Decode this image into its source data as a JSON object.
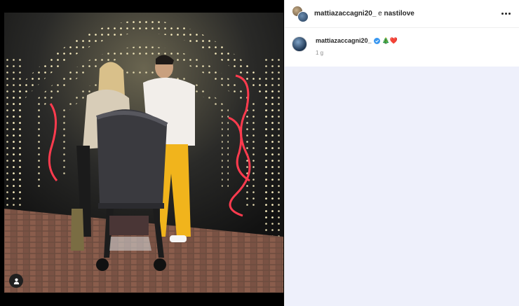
{
  "header": {
    "username": "mattiazaccagni20_",
    "connector": " e ",
    "collaborator": "nastilove"
  },
  "caption": {
    "username": "mattiazaccagni20_",
    "emojis": "🎄❤️",
    "time": "1 g"
  },
  "icons": {
    "more": "more-horizontal-icon",
    "tag": "user-tag-icon",
    "verified": "verified-badge-icon"
  },
  "colors": {
    "verified": "#3897f0",
    "comments_bg": "#eef0fb",
    "light_red": "#ff3b4e"
  }
}
